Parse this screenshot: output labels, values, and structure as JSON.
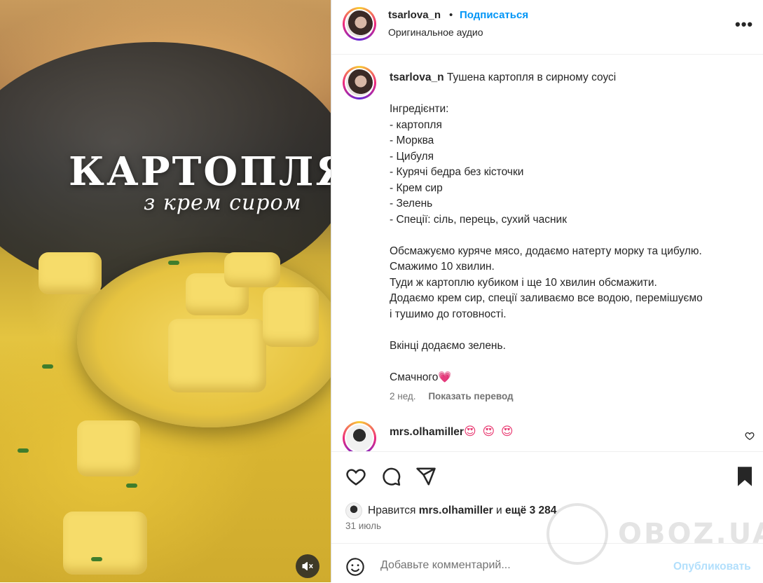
{
  "media": {
    "title_main": "КАРТОПЛЯ",
    "title_sub": "з крем сиром"
  },
  "header": {
    "username": "tsarlova_n",
    "separator": "•",
    "follow_label": "Подписаться",
    "audio": "Оригинальное аудио",
    "more": "•••"
  },
  "caption": {
    "username": "tsarlova_n",
    "title": "Тушена картопля в сирному соусі",
    "ingredients_header": "Інгредієнти:",
    "ingredients": [
      "- картопля",
      "- Морква",
      "- Цибуля",
      "- Курячі бедра без кісточки",
      "- Крем сир",
      "- Зелень",
      "- Спеції: сіль, перець, сухий часник"
    ],
    "steps": [
      "Обсмажуємо куряче мясо, додаємо натерту морку та цибулю.",
      "Смажимо 10 хвилин.",
      "Туди ж картоплю кубиком і ще 10 хвилин обсмажити.",
      "Додаємо крем сир, спеції заливаємо все водою, перемішуємо",
      "і тушимо до готовності."
    ],
    "final": "Вкінці додаємо зелень.",
    "closing": "Смачного",
    "closing_emoji": "💗",
    "time": "2 нед.",
    "translate_label": "Показать перевод"
  },
  "comment": {
    "username": "mrs.olhamiller",
    "text": "😍 😍 😍"
  },
  "likes": {
    "prefix": "Нравится",
    "user": "mrs.olhamiller",
    "and": "и",
    "count": "ещё 3 284"
  },
  "date": "31 июль",
  "comment_bar": {
    "placeholder": "Добавьте комментарий...",
    "post_label": "Опубликовать"
  },
  "watermark": "OBOZ.UA",
  "colors": {
    "link": "#0095f6",
    "post_disabled": "#b2dffc",
    "secondary_text": "#737373"
  }
}
